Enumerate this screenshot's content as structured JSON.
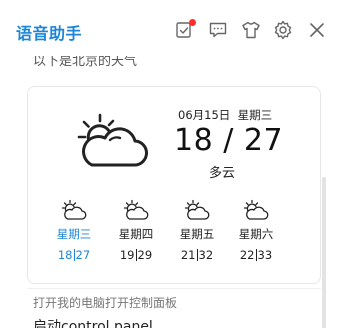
{
  "window": {
    "title": "语音助手"
  },
  "toolbar": {
    "icons": [
      "task-icon",
      "chat-icon",
      "shirt-icon",
      "gear-icon",
      "close-icon"
    ],
    "notification_dot_color": "#ff2d2d"
  },
  "conversation": {
    "previous_text": "以下是北京的天气",
    "weather": {
      "date": "06月15日",
      "weekday": "星期三",
      "low": "18",
      "separator": "/",
      "high": "27",
      "condition": "多云",
      "icon": "partly-cloudy-icon",
      "forecast": [
        {
          "day": "星期三",
          "low": "18",
          "high": "27",
          "active": true
        },
        {
          "day": "星期四",
          "low": "19",
          "high": "29",
          "active": false
        },
        {
          "day": "星期五",
          "low": "21",
          "high": "32",
          "active": false
        },
        {
          "day": "星期六",
          "low": "22",
          "high": "33",
          "active": false
        }
      ]
    },
    "command_hint": "打开我的电脑打开控制面板",
    "command_text": "启动control panel"
  },
  "colors": {
    "accent": "#1e86d8",
    "text": "#222222",
    "muted": "#777777"
  }
}
